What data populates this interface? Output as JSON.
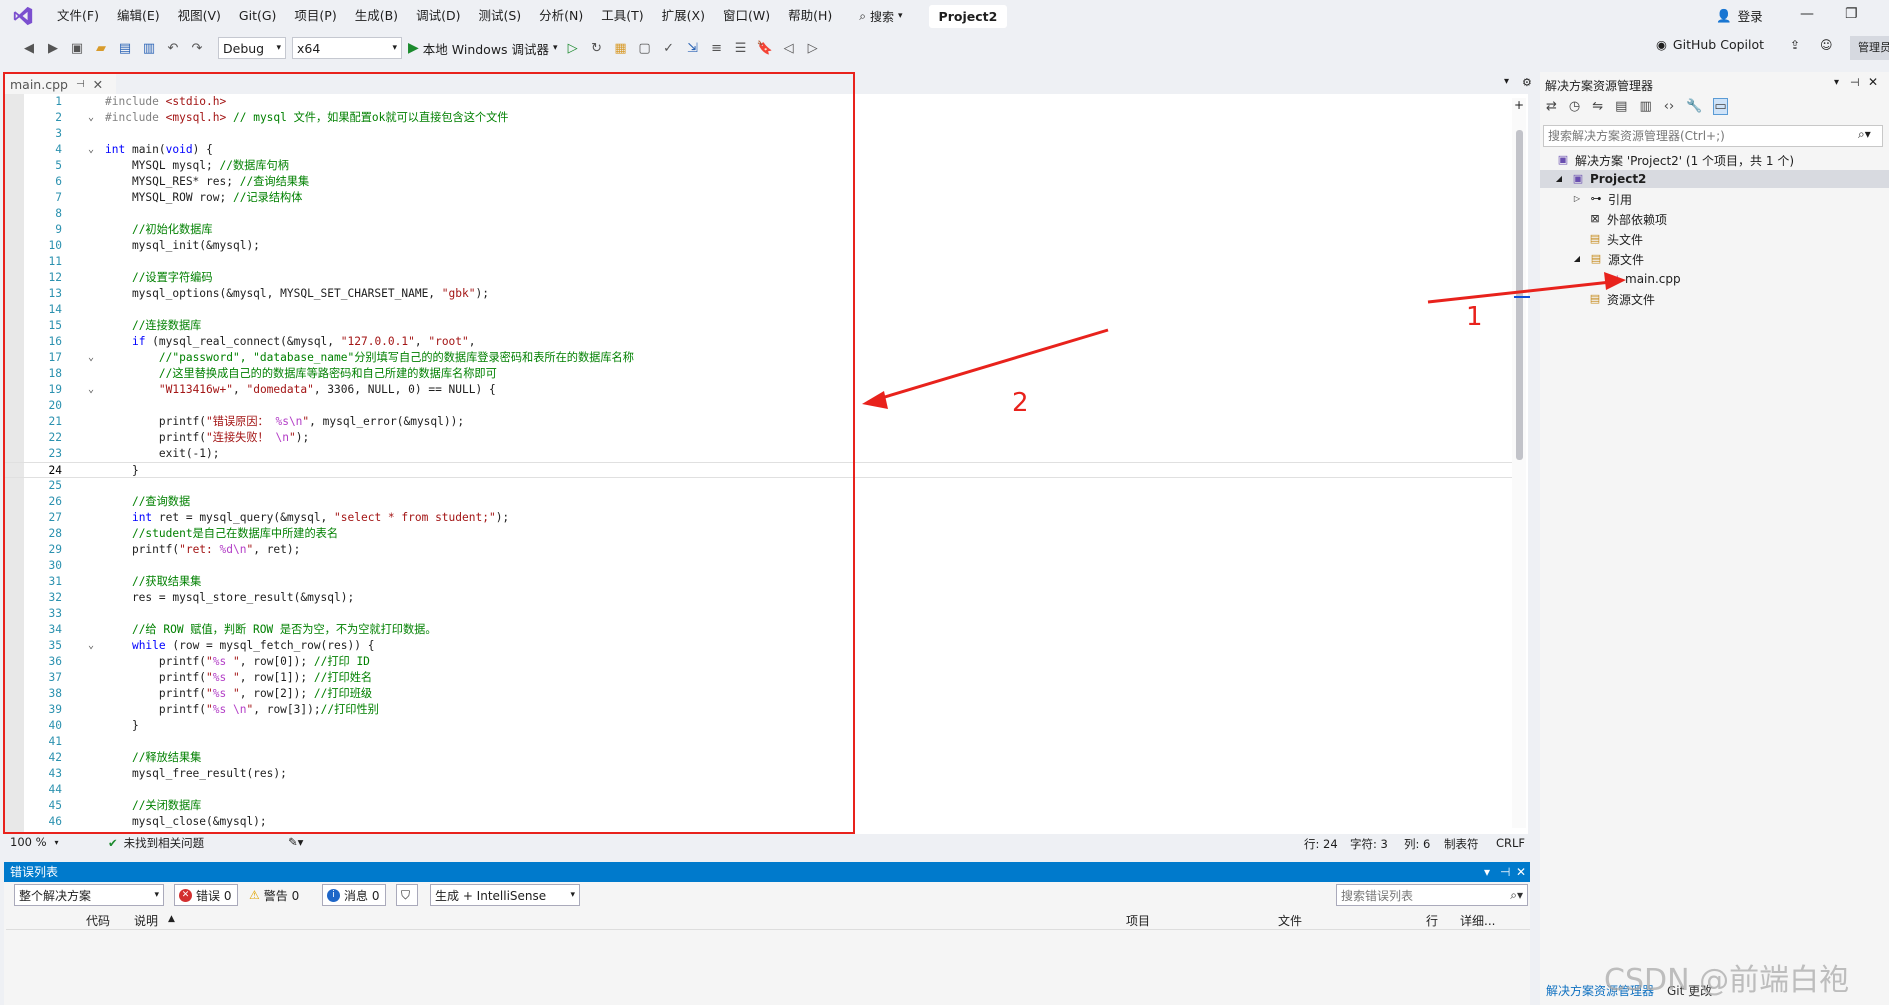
{
  "menubar": {
    "items": [
      "文件(F)",
      "编辑(E)",
      "视图(V)",
      "Git(G)",
      "项目(P)",
      "生成(B)",
      "调试(D)",
      "测试(S)",
      "分析(N)",
      "工具(T)",
      "扩展(X)",
      "窗口(W)",
      "帮助(H)"
    ],
    "search": "搜索",
    "project": "Project2",
    "login": "登录"
  },
  "toolbar": {
    "config": "Debug",
    "platform": "x64",
    "run_label": "本地 Windows 调试器",
    "copilot": "GitHub Copilot",
    "admin": "管理员"
  },
  "editor": {
    "tab": "main.cpp",
    "zoom": "100 %",
    "issues": "未找到相关问题",
    "pos_line": "行: 24",
    "pos_char": "字符: 3",
    "pos_col": "列: 6",
    "indent": "制表符",
    "eol": "CRLF",
    "lines": [
      {
        "n": "1",
        "html": "<span class='pp'>#include </span><span class='str'>&lt;stdio.h&gt;</span>"
      },
      {
        "n": "2",
        "html": "<span class='pp'>#include </span><span class='str'>&lt;mysql.h&gt;</span> <span class='cm'>// mysql 文件，如果配置ok就可以直接包含这个文件</span>"
      },
      {
        "n": "3",
        "html": ""
      },
      {
        "n": "4",
        "html": "<span class='kw'>int</span> main(<span class='kw'>void</span>) {"
      },
      {
        "n": "5",
        "html": "    MYSQL mysql; <span class='cm'>//数据库句柄</span>"
      },
      {
        "n": "6",
        "html": "    MYSQL_RES* res; <span class='cm'>//查询结果集</span>"
      },
      {
        "n": "7",
        "html": "    MYSQL_ROW row; <span class='cm'>//记录结构体</span>"
      },
      {
        "n": "8",
        "html": ""
      },
      {
        "n": "9",
        "html": "    <span class='cm'>//初始化数据库</span>"
      },
      {
        "n": "10",
        "html": "    mysql_init(&amp;mysql);"
      },
      {
        "n": "11",
        "html": ""
      },
      {
        "n": "12",
        "html": "    <span class='cm'>//设置字符编码</span>"
      },
      {
        "n": "13",
        "html": "    mysql_options(&amp;mysql, MYSQL_SET_CHARSET_NAME, <span class='str'>\"gbk\"</span>);"
      },
      {
        "n": "14",
        "html": ""
      },
      {
        "n": "15",
        "html": "    <span class='cm'>//连接数据库</span>"
      },
      {
        "n": "16",
        "html": "    <span class='kw'>if</span> (mysql_real_connect(&amp;mysql, <span class='str'>\"127.0.0.1\"</span>, <span class='str'>\"root\"</span>,"
      },
      {
        "n": "17",
        "html": "        <span class='cm'>//\"password\", \"database_name\"分别填写自己的的数据库登录密码和表所在的数据库名称</span>"
      },
      {
        "n": "18",
        "html": "        <span class='cm'>//这里替换成自己的的数据库等路密码和自己所建的数据库名称即可</span>"
      },
      {
        "n": "19",
        "html": "        <span class='str'>\"W113416w+\"</span>, <span class='str'>\"domedata\"</span>, 3306, NULL, 0) == NULL) {"
      },
      {
        "n": "20",
        "html": ""
      },
      {
        "n": "21",
        "html": "        printf(<span class='str'>\"错误原因： </span><span class='fmt'>%s\\n</span><span class='str'>\"</span>, mysql_error(&amp;mysql));"
      },
      {
        "n": "22",
        "html": "        printf(<span class='str'>\"连接失败！ </span><span class='fmt'>\\n</span><span class='str'>\"</span>);"
      },
      {
        "n": "23",
        "html": "        exit(-1);"
      },
      {
        "n": "24",
        "html": "    }"
      },
      {
        "n": "25",
        "html": ""
      },
      {
        "n": "26",
        "html": "    <span class='cm'>//查询数据</span>"
      },
      {
        "n": "27",
        "html": "    <span class='kw'>int</span> ret = mysql_query(&amp;mysql, <span class='str'>\"select * from student;\"</span>);"
      },
      {
        "n": "28",
        "html": "    <span class='cm'>//student是自己在数据库中所建的表名</span>"
      },
      {
        "n": "29",
        "html": "    printf(<span class='str'>\"ret: </span><span class='fmt'>%d\\n</span><span class='str'>\"</span>, ret);"
      },
      {
        "n": "30",
        "html": ""
      },
      {
        "n": "31",
        "html": "    <span class='cm'>//获取结果集</span>"
      },
      {
        "n": "32",
        "html": "    res = mysql_store_result(&amp;mysql);"
      },
      {
        "n": "33",
        "html": ""
      },
      {
        "n": "34",
        "html": "    <span class='cm'>//给 ROW 赋值，判断 ROW 是否为空，不为空就打印数据。</span>"
      },
      {
        "n": "35",
        "html": "    <span class='kw'>while</span> (row = mysql_fetch_row(res)) {"
      },
      {
        "n": "36",
        "html": "        printf(<span class='str'>\"</span><span class='fmt'>%s</span><span class='str'> \"</span>, row[0]); <span class='cm'>//打印 ID</span>"
      },
      {
        "n": "37",
        "html": "        printf(<span class='str'>\"</span><span class='fmt'>%s</span><span class='str'> \"</span>, row[1]); <span class='cm'>//打印姓名</span>"
      },
      {
        "n": "38",
        "html": "        printf(<span class='str'>\"</span><span class='fmt'>%s</span><span class='str'> \"</span>, row[2]); <span class='cm'>//打印班级</span>"
      },
      {
        "n": "39",
        "html": "        printf(<span class='str'>\"</span><span class='fmt'>%s \\n</span><span class='str'>\"</span>, row[3]);<span class='cm'>//打印性别</span>"
      },
      {
        "n": "40",
        "html": "    }"
      },
      {
        "n": "41",
        "html": ""
      },
      {
        "n": "42",
        "html": "    <span class='cm'>//释放结果集</span>"
      },
      {
        "n": "43",
        "html": "    mysql_free_result(res);"
      },
      {
        "n": "44",
        "html": ""
      },
      {
        "n": "45",
        "html": "    <span class='cm'>//关闭数据库</span>"
      },
      {
        "n": "46",
        "html": "    mysql_close(&amp;mysql);"
      }
    ]
  },
  "errorlist": {
    "title": "错误列表",
    "scope": "整个解决方案",
    "errors": "错误 0",
    "warnings": "警告 0",
    "messages": "消息 0",
    "build": "生成 + IntelliSense",
    "search": "搜索错误列表",
    "col_code": "代码",
    "col_desc": "说明",
    "col_project": "项目",
    "col_file": "文件",
    "col_line": "行",
    "col_detail": "详细..."
  },
  "solution": {
    "title": "解决方案资源管理器",
    "search": "搜索解决方案资源管理器(Ctrl+;)",
    "root": "解决方案 'Project2' (1 个项目，共 1 个)",
    "project": "Project2",
    "refs": "引用",
    "external": "外部依赖项",
    "headers": "头文件",
    "sources": "源文件",
    "main": "main.cpp",
    "resources": "资源文件",
    "tab_explorer": "解决方案资源管理器",
    "tab_git": "Git 更改"
  },
  "annotations": {
    "one": "1",
    "two": "2"
  },
  "watermark": "CSDN @前端白袍"
}
